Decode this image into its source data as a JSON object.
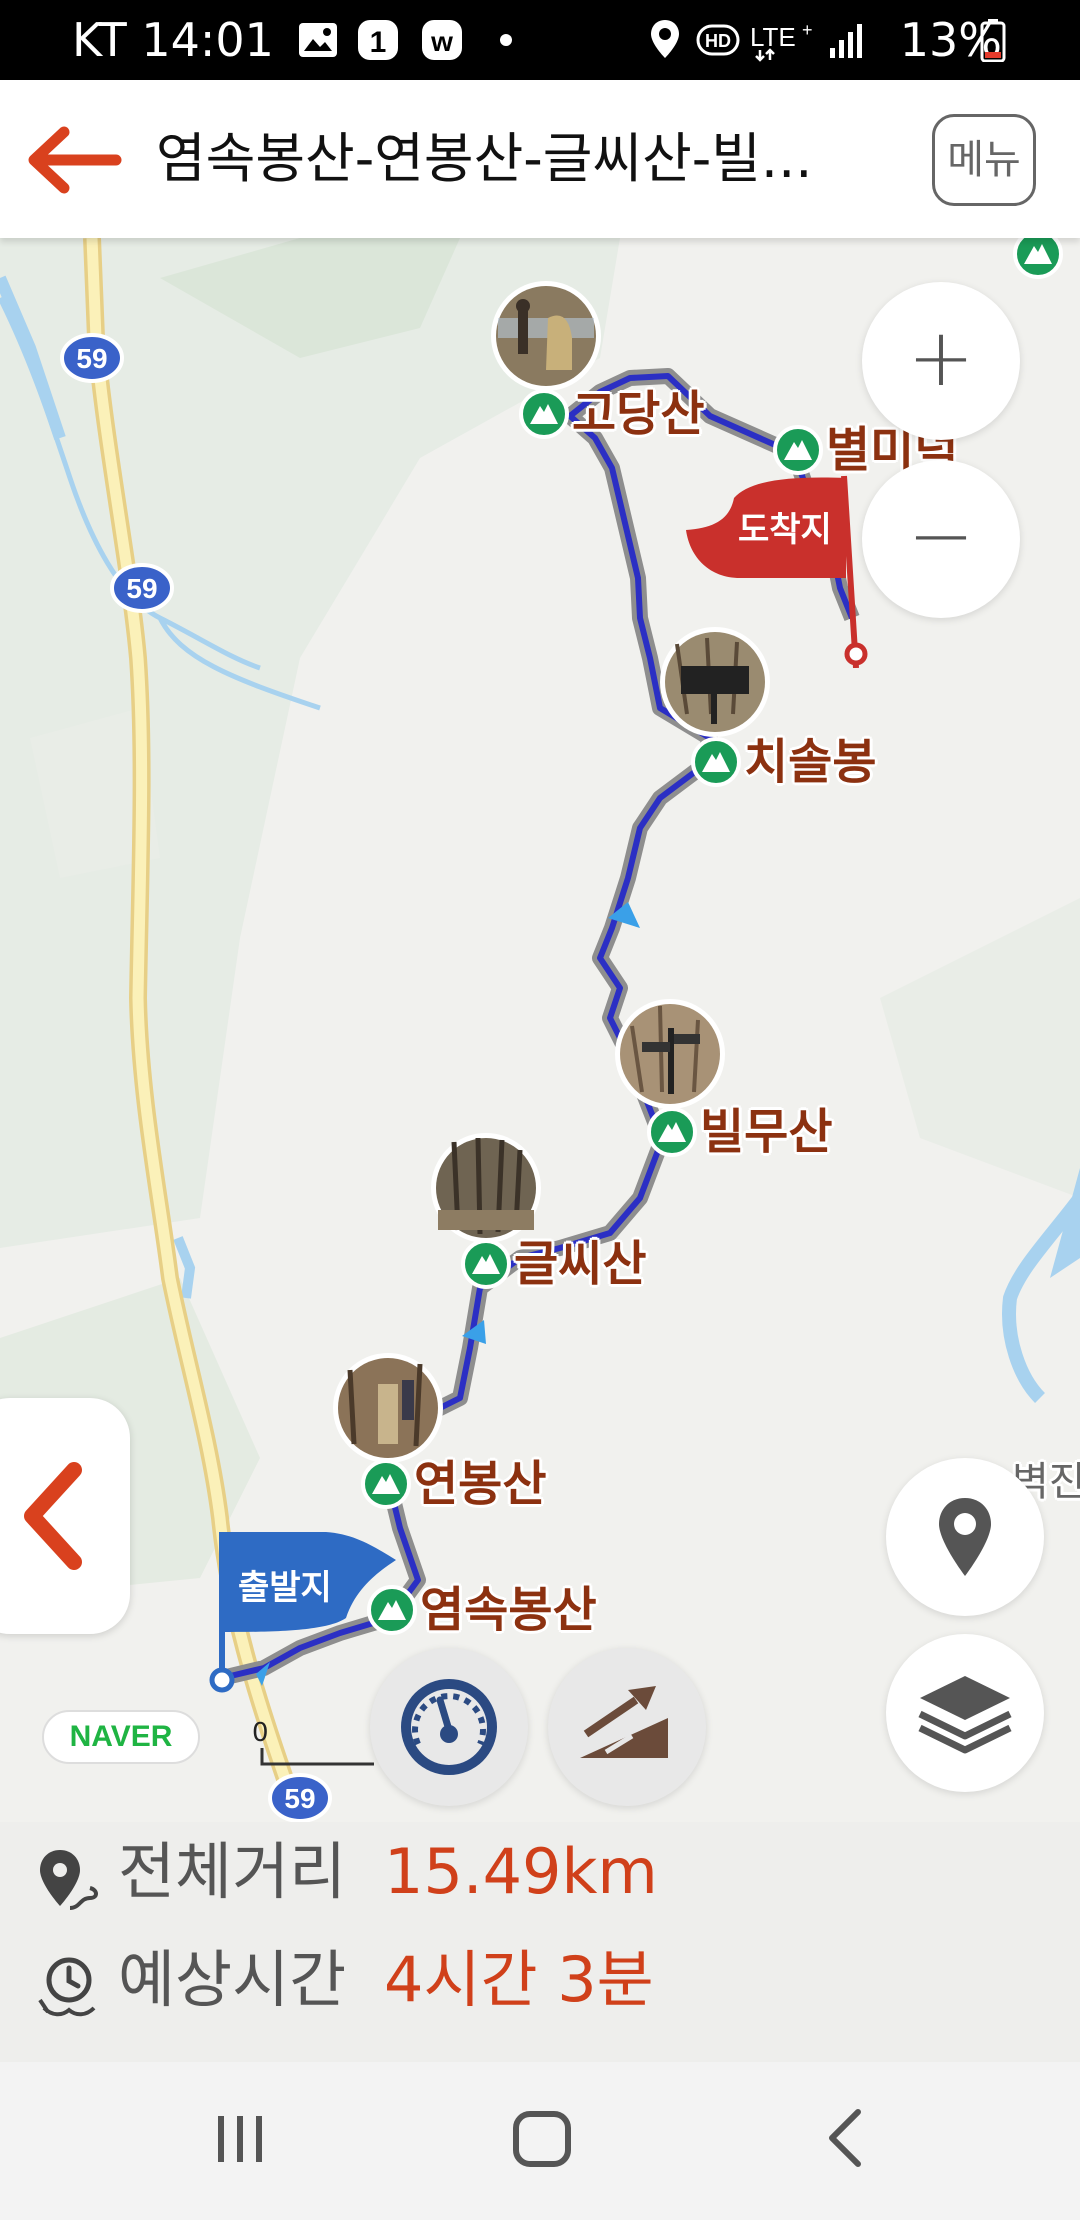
{
  "status_bar": {
    "carrier_time": "KT 14:01",
    "battery": "13%",
    "notification_icons": [
      "image-icon",
      "badge-1-icon",
      "w-icon",
      "dot-icon"
    ],
    "system_icons": [
      "location-icon",
      "hd-icon",
      "lte-icon",
      "signal-icon",
      "battery-icon"
    ]
  },
  "header": {
    "title": "염속봉산-연봉산-글씨산-빌...",
    "menu_label": "메뉴",
    "accent_color": "#d9411e"
  },
  "map": {
    "road_labels": [
      "59",
      "59",
      "59"
    ],
    "peaks": [
      {
        "name": "고당산",
        "photo": true
      },
      {
        "name": "별미덕",
        "photo": false
      },
      {
        "name": "치솔봉",
        "photo": true
      },
      {
        "name": "빌무산",
        "photo": true
      },
      {
        "name": "글씨산",
        "photo": true
      },
      {
        "name": "연봉산",
        "photo": true
      },
      {
        "name": "염속봉산",
        "photo": false
      }
    ],
    "arrival_flag": "도착지",
    "departure_flag": "출발지",
    "partial_place_label": "벽진",
    "provider": "NAVER",
    "scale_zero": "0",
    "route_color": "#2b2fc4",
    "peak_marker_color": "#1a9b57"
  },
  "controls": {
    "zoom_in": "+",
    "zoom_out": "−"
  },
  "info": {
    "distance_label": "전체거리",
    "distance_value": "15.49km",
    "time_label": "예상시간",
    "time_value": "4시간 3분"
  }
}
